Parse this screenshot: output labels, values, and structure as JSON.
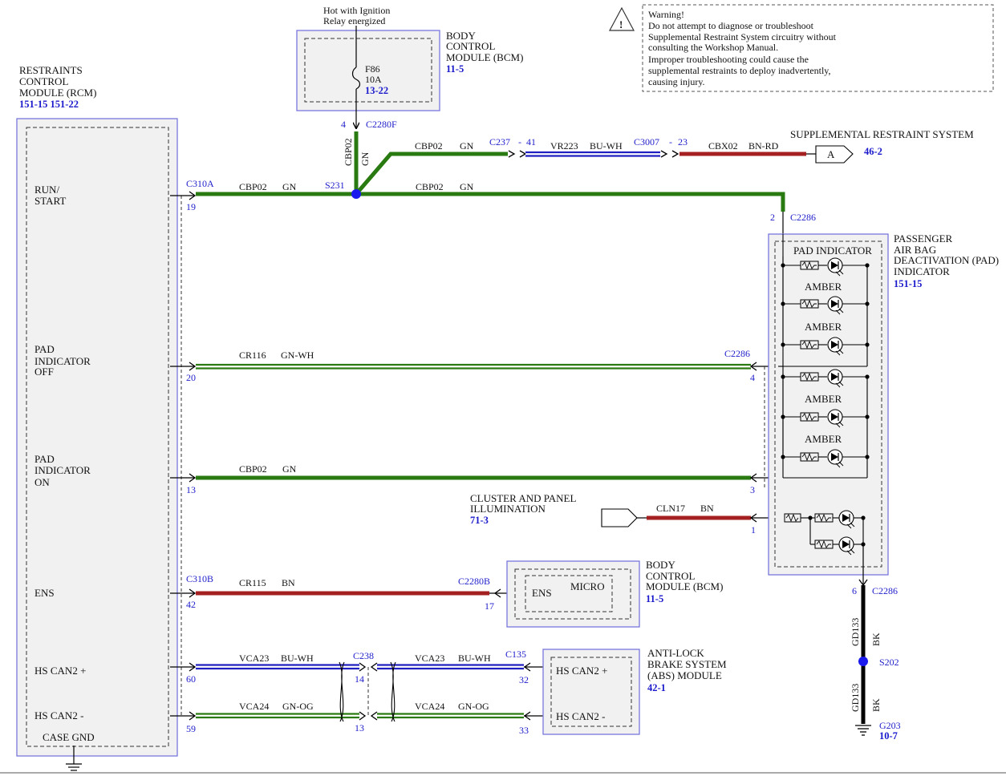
{
  "colors": {
    "green": "#2a7a12",
    "blue": "#2020c0",
    "red": "#a52020",
    "black": "#000000",
    "module_border": "#7777dd",
    "module_fill": "#f1f1f1",
    "ref_blue": "#1a1acc"
  },
  "warning": {
    "lines": [
      "Warning!",
      "Do not attempt to diagnose or troubleshoot",
      "Supplemental Restraint System circuitry without",
      "consulting the Workshop Manual.",
      "Improper troubleshooting could cause the",
      "supplemental restraints to deploy inadvertently,",
      "causing injury."
    ]
  },
  "rcm": {
    "title": [
      "RESTRAINTS",
      "CONTROL",
      "MODULE (RCM)"
    ],
    "refs": "151-15  151-22",
    "pins": {
      "run_start": [
        "RUN/",
        "START"
      ],
      "pad_off": [
        "PAD",
        "INDICATOR",
        "OFF"
      ],
      "pad_on": [
        "PAD",
        "INDICATOR",
        "ON"
      ],
      "ens": "ENS",
      "can_plus": "HS CAN2 +",
      "can_minus": "HS CAN2 -",
      "case_gnd": "CASE GND"
    }
  },
  "bcm_top": {
    "title": [
      "BODY",
      "CONTROL",
      "MODULE (BCM)"
    ],
    "ref": "11-5",
    "hot_note": [
      "Hot with Ignition",
      "Relay energized"
    ],
    "fuse": "F86",
    "fuse_rating": "10A",
    "fuse_ref": "13-22",
    "pin": "4",
    "connector": "C2280F"
  },
  "bcm_bottom": {
    "title": [
      "BODY",
      "CONTROL",
      "MODULE (BCM)"
    ],
    "ref": "11-5",
    "ens": "ENS",
    "micro": "MICRO",
    "pin": "17",
    "connector": "C2280B"
  },
  "srs": {
    "label": "SUPPLEMENTAL RESTRAINT SYSTEM",
    "ref": "46-2",
    "arrow": "A"
  },
  "pad_module": {
    "title": [
      "PASSENGER",
      "AIR BAG",
      "DEACTIVATION (PAD)",
      "INDICATOR"
    ],
    "ref": "151-15",
    "header": "PAD INDICATOR",
    "amber_labels": [
      "AMBER",
      "AMBER",
      "AMBER",
      "AMBER"
    ],
    "connector": "C2286",
    "pins": {
      "supply": "2",
      "off": "4",
      "on": "3",
      "illum": "1",
      "gnd": "6"
    }
  },
  "cluster": {
    "label": [
      "CLUSTER AND PANEL",
      "ILLUMINATION"
    ],
    "ref": "71-3"
  },
  "abs": {
    "title": [
      "ANTI-LOCK",
      "BRAKE SYSTEM",
      "(ABS) MODULE"
    ],
    "ref": "42-1",
    "can_plus": "HS CAN2 +",
    "can_minus": "HS CAN2 -",
    "pin_plus": "32",
    "pin_minus": "33",
    "connector": "C135"
  },
  "wires": {
    "run_start": {
      "circuit": "CBP02",
      "color": "GN",
      "connector": "C310A",
      "pin": "19",
      "splice": "S231"
    },
    "to_pad_supply": {
      "circuit": "CBP02",
      "color": "GN"
    },
    "vertical_bcm": {
      "circuit": "CBP02",
      "color": "GN"
    },
    "to_c237": {
      "circuit": "CBP02",
      "color": "GN",
      "connector": "C237",
      "pin": "41"
    },
    "vr223": {
      "circuit": "VR223",
      "color": "BU-WH",
      "connector": "C3007",
      "pin": "23"
    },
    "cbx02": {
      "circuit": "CBX02",
      "color": "BN-RD"
    },
    "pad_off": {
      "circuit": "CR116",
      "color": "GN-WH",
      "pin": "20",
      "connector": "C2286"
    },
    "pad_on": {
      "circuit": "CBP02",
      "color": "GN",
      "pin": "13"
    },
    "cln17": {
      "circuit": "CLN17",
      "color": "BN"
    },
    "ens": {
      "circuit": "CR115",
      "color": "BN",
      "connector": "C310B",
      "pin": "42"
    },
    "can_plus_left": {
      "circuit": "VCA23",
      "color": "BU-WH",
      "pin": "60"
    },
    "can_plus_right": {
      "circuit": "VCA23",
      "color": "BU-WH"
    },
    "can_minus_left": {
      "circuit": "VCA24",
      "color": "GN-OG",
      "pin": "59"
    },
    "can_minus_right": {
      "circuit": "VCA24",
      "color": "GN-OG"
    },
    "c238": {
      "connector": "C238",
      "pin_plus": "14",
      "pin_minus": "13"
    },
    "ground": {
      "circuit": "GD133",
      "color": "BK",
      "splice": "S202",
      "ground": "G203",
      "ground_ref": "10-7"
    }
  }
}
